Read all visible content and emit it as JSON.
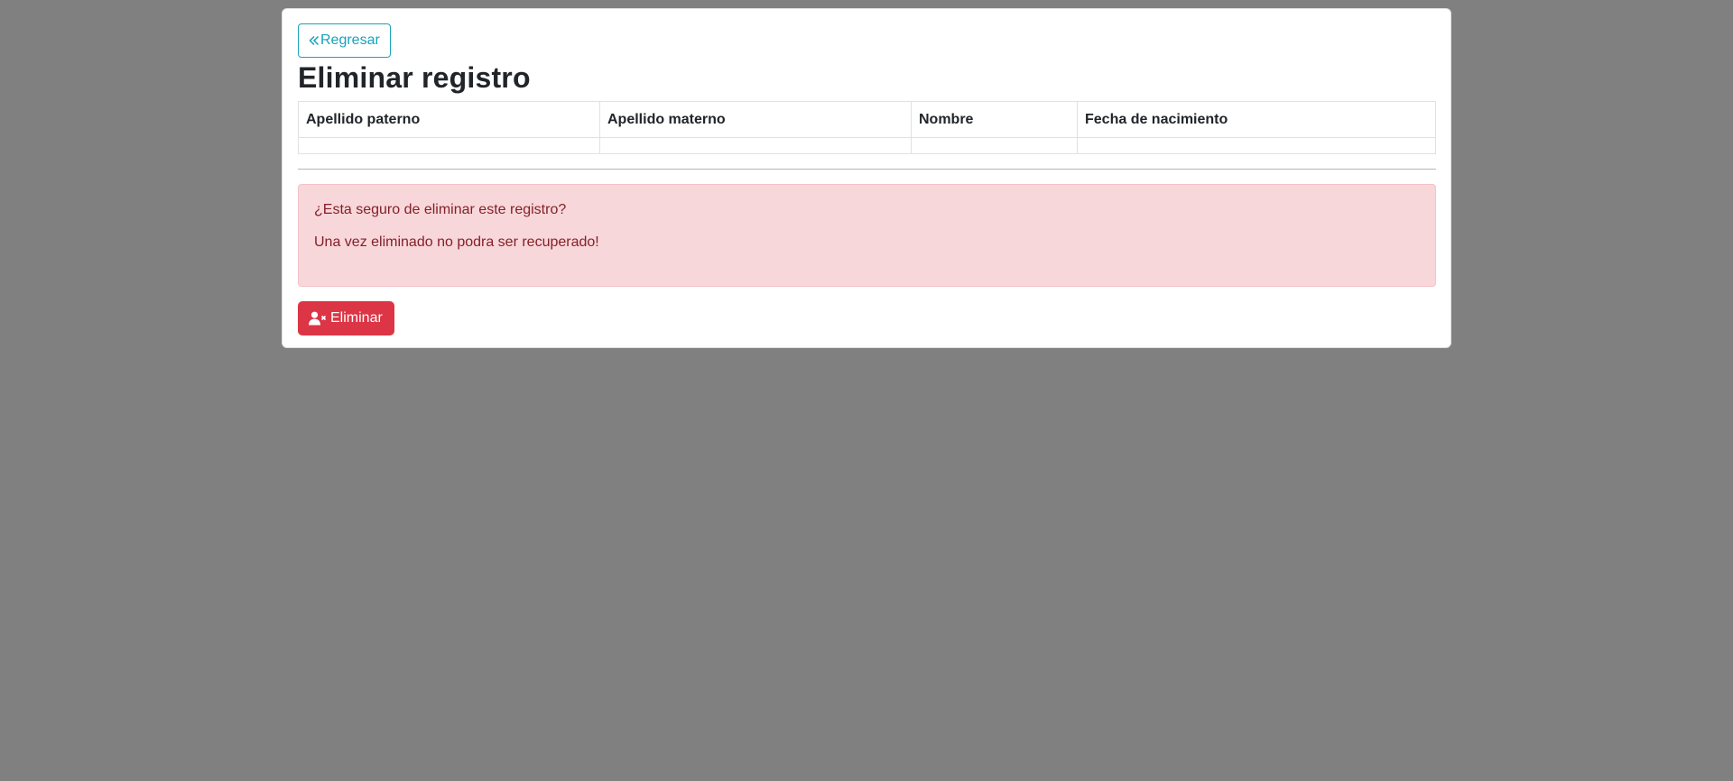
{
  "back_button": {
    "label": "Regresar",
    "icon": "chevrons-left-icon"
  },
  "page_title": "Eliminar registro",
  "table": {
    "columns": [
      "Apellido paterno",
      "Apellido materno",
      "Nombre",
      "Fecha de nacimiento"
    ],
    "rows": [
      [
        "",
        "",
        "",
        ""
      ]
    ]
  },
  "alert": {
    "line1": "¿Esta seguro de eliminar este registro?",
    "line2": "Una vez eliminado no podra ser recuperado!"
  },
  "delete_button": {
    "label": "Eliminar",
    "icon": "user-delete-icon"
  },
  "colors": {
    "background": "#808080",
    "info": "#17a2b8",
    "danger": "#dc3545",
    "alert_bg": "#f8d7da",
    "alert_text": "#842029"
  }
}
